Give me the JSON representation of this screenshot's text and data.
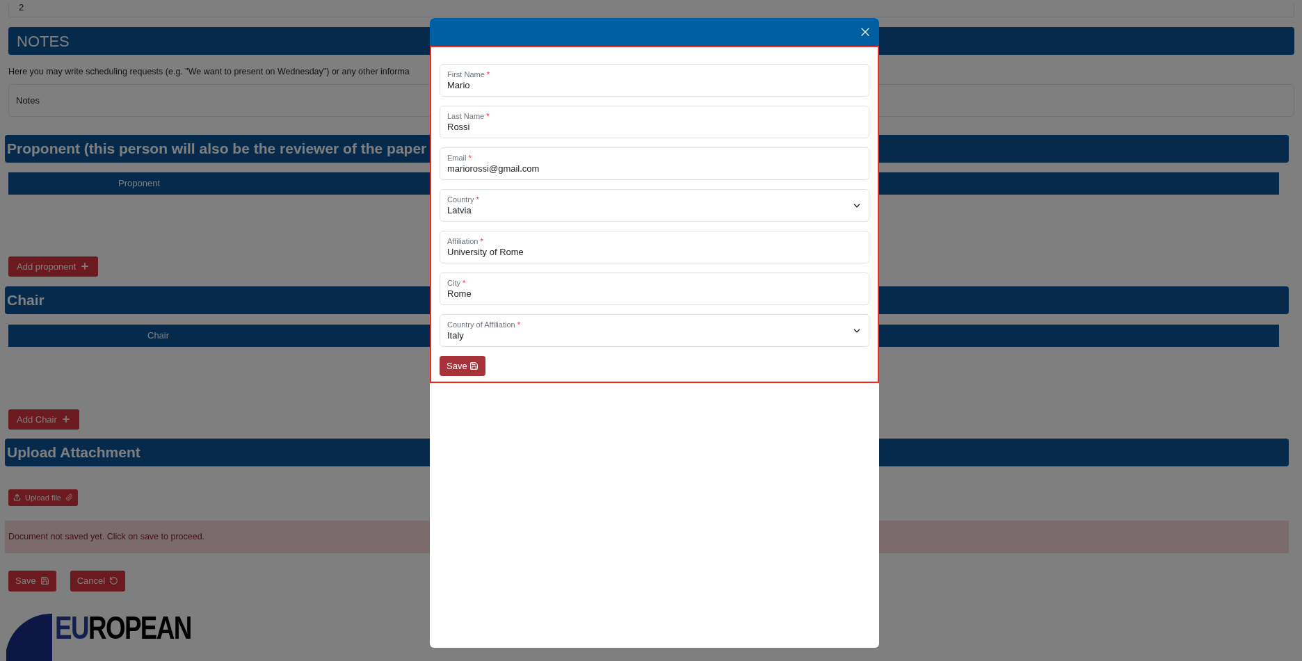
{
  "page": {
    "top_field": {
      "value": "2"
    },
    "notes": {
      "title": "NOTES",
      "description": "Here you may write scheduling requests (e.g. \"We want to present on Wednesday\") or any other informa",
      "field": {
        "placeholder": "Notes"
      }
    },
    "proponent": {
      "title": "Proponent (this person will also be the reviewer of the paper",
      "column": "Proponent",
      "add_button": "Add proponent"
    },
    "chair": {
      "title": "Chair",
      "column": "Chair",
      "add_button": "Add Chair"
    },
    "upload": {
      "title": "Upload Attachment",
      "button": "Upload file"
    },
    "alert": "Document not saved yet. Click on save to proceed.",
    "actions": [
      {
        "label": "Save",
        "kind": "save"
      },
      {
        "label": "Cancel",
        "kind": "cancel"
      }
    ],
    "logo": {
      "line1_accent": "EU",
      "line1_rest": "ROPEAN"
    }
  },
  "modal": {
    "fields": [
      {
        "label": "First Name",
        "required": "*",
        "value": "Mario",
        "kind": "text"
      },
      {
        "label": "Last Name",
        "required": "*",
        "value": "Rossi",
        "kind": "text"
      },
      {
        "label": "Email",
        "required": "*",
        "value": "mariorossi@gmail.com",
        "kind": "text"
      },
      {
        "label": "Country",
        "required": "*",
        "value": "Latvia",
        "kind": "select"
      },
      {
        "label": "Affiliation",
        "required": "*",
        "value": "University of Rome",
        "kind": "text"
      },
      {
        "label": "City",
        "required": "*",
        "value": "Rome",
        "kind": "text"
      },
      {
        "label": "Country of Affiliation",
        "required": "*",
        "value": "Italy",
        "kind": "select"
      }
    ],
    "save_button": "Save"
  }
}
